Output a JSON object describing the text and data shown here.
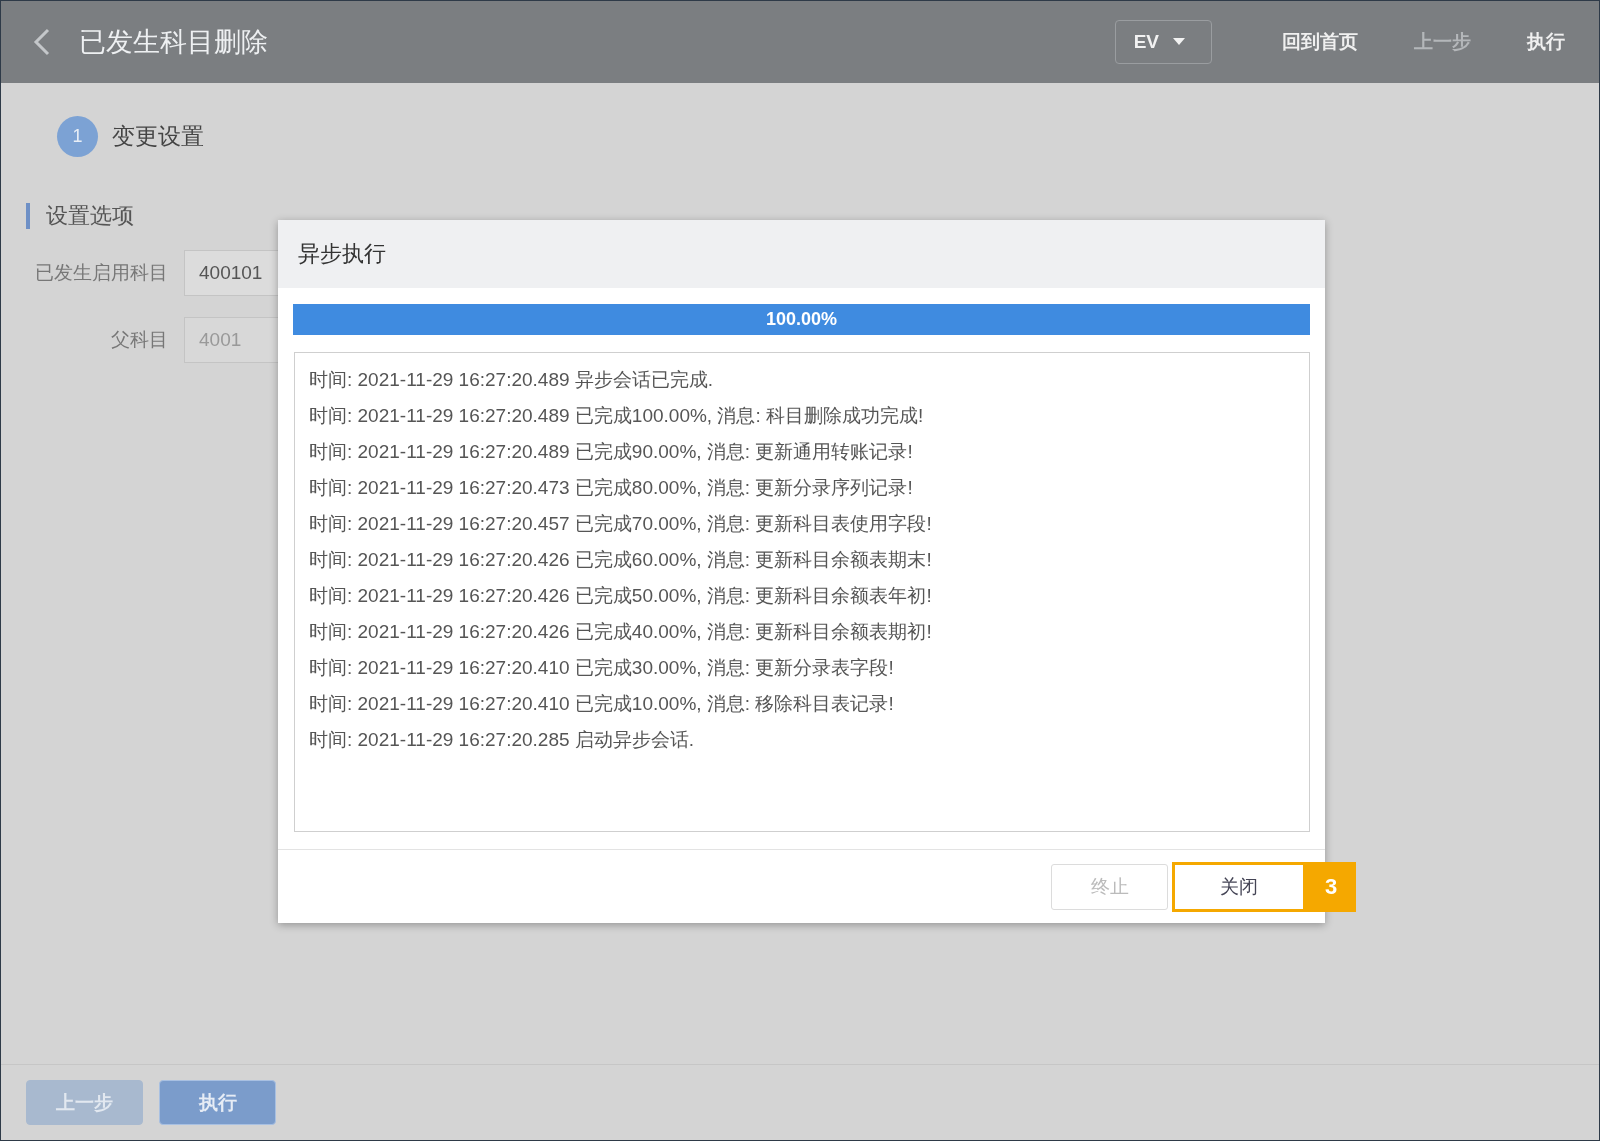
{
  "header": {
    "title": "已发生科目删除",
    "dropdown": {
      "value": "EV"
    },
    "actions": [
      {
        "label": "回到首页",
        "disabled": false
      },
      {
        "label": "上一步",
        "disabled": true
      },
      {
        "label": "执行",
        "disabled": false
      }
    ]
  },
  "steps": [
    {
      "number": "1",
      "label": "变更设置"
    }
  ],
  "section": {
    "title": "设置选项",
    "fields": [
      {
        "label": "已发生启用科目",
        "value": "400101",
        "disabled": false
      },
      {
        "label": "父科目",
        "value": "4001",
        "disabled": true
      }
    ]
  },
  "dialog": {
    "title": "异步执行",
    "progress": {
      "level": 1,
      "reading": "100.00%"
    },
    "log": [
      "时间: 2021-11-29 16:27:20.489 异步会话已完成.",
      "时间: 2021-11-29 16:27:20.489 已完成100.00%, 消息: 科目删除成功完成!",
      "时间: 2021-11-29 16:27:20.489 已完成90.00%, 消息: 更新通用转账记录!",
      "时间: 2021-11-29 16:27:20.473 已完成80.00%, 消息: 更新分录序列记录!",
      "时间: 2021-11-29 16:27:20.457 已完成70.00%, 消息: 更新科目表使用字段!",
      "时间: 2021-11-29 16:27:20.426 已完成60.00%, 消息: 更新科目余额表期末!",
      "时间: 2021-11-29 16:27:20.426 已完成50.00%, 消息: 更新科目余额表年初!",
      "时间: 2021-11-29 16:27:20.426 已完成40.00%, 消息: 更新科目余额表期初!",
      "时间: 2021-11-29 16:27:20.410 已完成30.00%, 消息: 更新分录表字段!",
      "时间: 2021-11-29 16:27:20.410 已完成10.00%, 消息: 移除科目表记录!",
      "时间: 2021-11-29 16:27:20.285 启动异步会话."
    ],
    "buttons": [
      {
        "label": "终止",
        "disabled": true,
        "highlighted": false
      },
      {
        "label": "关闭",
        "disabled": false,
        "highlighted": true
      }
    ],
    "callout": "3"
  },
  "footer": {
    "buttons": [
      {
        "label": "上一步",
        "disabled": true
      },
      {
        "label": "执行",
        "disabled": false
      }
    ]
  }
}
